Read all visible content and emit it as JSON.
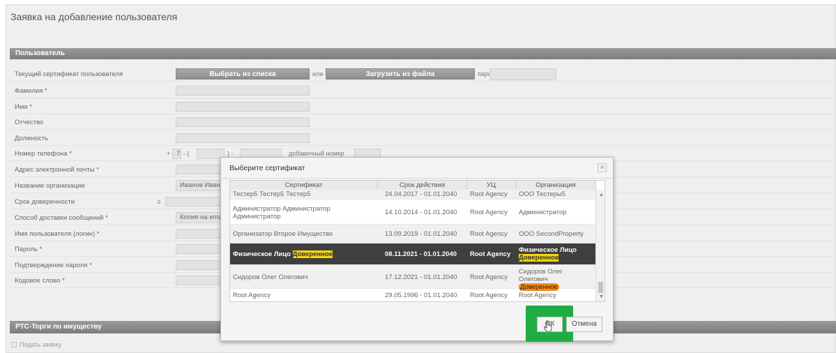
{
  "page_title": "Заявка на добавление пользователя",
  "section_user": "Пользователь",
  "section_rts": "РТС-Торги по имуществу",
  "cert_row": {
    "label": "Текущий сертификат пользователя",
    "btn_list": "Выбрать из списка",
    "or": "или",
    "btn_file": "Загрузить из файла",
    "password": "пароль:"
  },
  "fields": {
    "surname": "Фамилия *",
    "name": "Имя *",
    "patronymic": "Отчество",
    "position": "Должность",
    "phone": "Номер телефона *",
    "email": "Адрес электронной почты *",
    "org": "Название организации",
    "validity": "Срок доверенности",
    "delivery": "Способ доставки сообщений *",
    "login": "Имя пользователя (логин) *",
    "pass": "Пароль *",
    "pass_confirm": "Подтверждение пароля *",
    "code": "Кодовое слово *"
  },
  "phone": {
    "plus": "+",
    "code": "7",
    "open": "- (",
    "close": ") -",
    "ext_label": "добавочный номер"
  },
  "org_value": "Иванов Иван",
  "validity_from": "с",
  "delivery_value": "Копия на ema",
  "submit_label": "Подать заявку",
  "modal": {
    "title": "Выберите сертификат",
    "close": "×",
    "columns": [
      "Сертификат",
      "Срок действия",
      "УЦ",
      "Организация"
    ],
    "rows": [
      {
        "cert": "Тестер5 Тестер5 Тестер5",
        "period": "24.04.2017 - 01.01.2040",
        "ca": "Root Agency",
        "org": "ООО Тестеры5"
      },
      {
        "cert": "Администратор Администратор Администратор",
        "period": "14.10.2014 - 01.01.2040",
        "ca": "Root Agency",
        "org": "Администратор"
      },
      {
        "cert": "Организатор Второе Имущество",
        "period": "13.09.2019 - 01.01.2040",
        "ca": "Root Agency",
        "org": "ООО SecondProperty"
      },
      {
        "cert_main": "Физическое Лицо",
        "cert_tag": "Доверенное",
        "period": "08.11.2021 - 01.01.2040",
        "ca": "Root Agency",
        "org_main": "Физическое Лицо",
        "org_tag": "Доверенное"
      },
      {
        "cert": "Сидоров Олег Олегович",
        "period": "17.12.2021 - 01.01.2040",
        "ca": "Root Agency",
        "org_main": "Сидоров Олег Олегович",
        "org_tag": "Доверенное"
      },
      {
        "cert": "Root Agency",
        "period": "29.05.1996 - 01.01.2040",
        "ca": "Root Agency",
        "org": "Root Agency"
      }
    ],
    "ok": "ОК",
    "cancel": "Отмена"
  },
  "colors": {
    "highlight": "#f5d70a",
    "badge": "#f08a1c",
    "focus_box": "#1fad43",
    "selected_row": "#3f3f3f",
    "section_bar": "#8a8a8a"
  }
}
